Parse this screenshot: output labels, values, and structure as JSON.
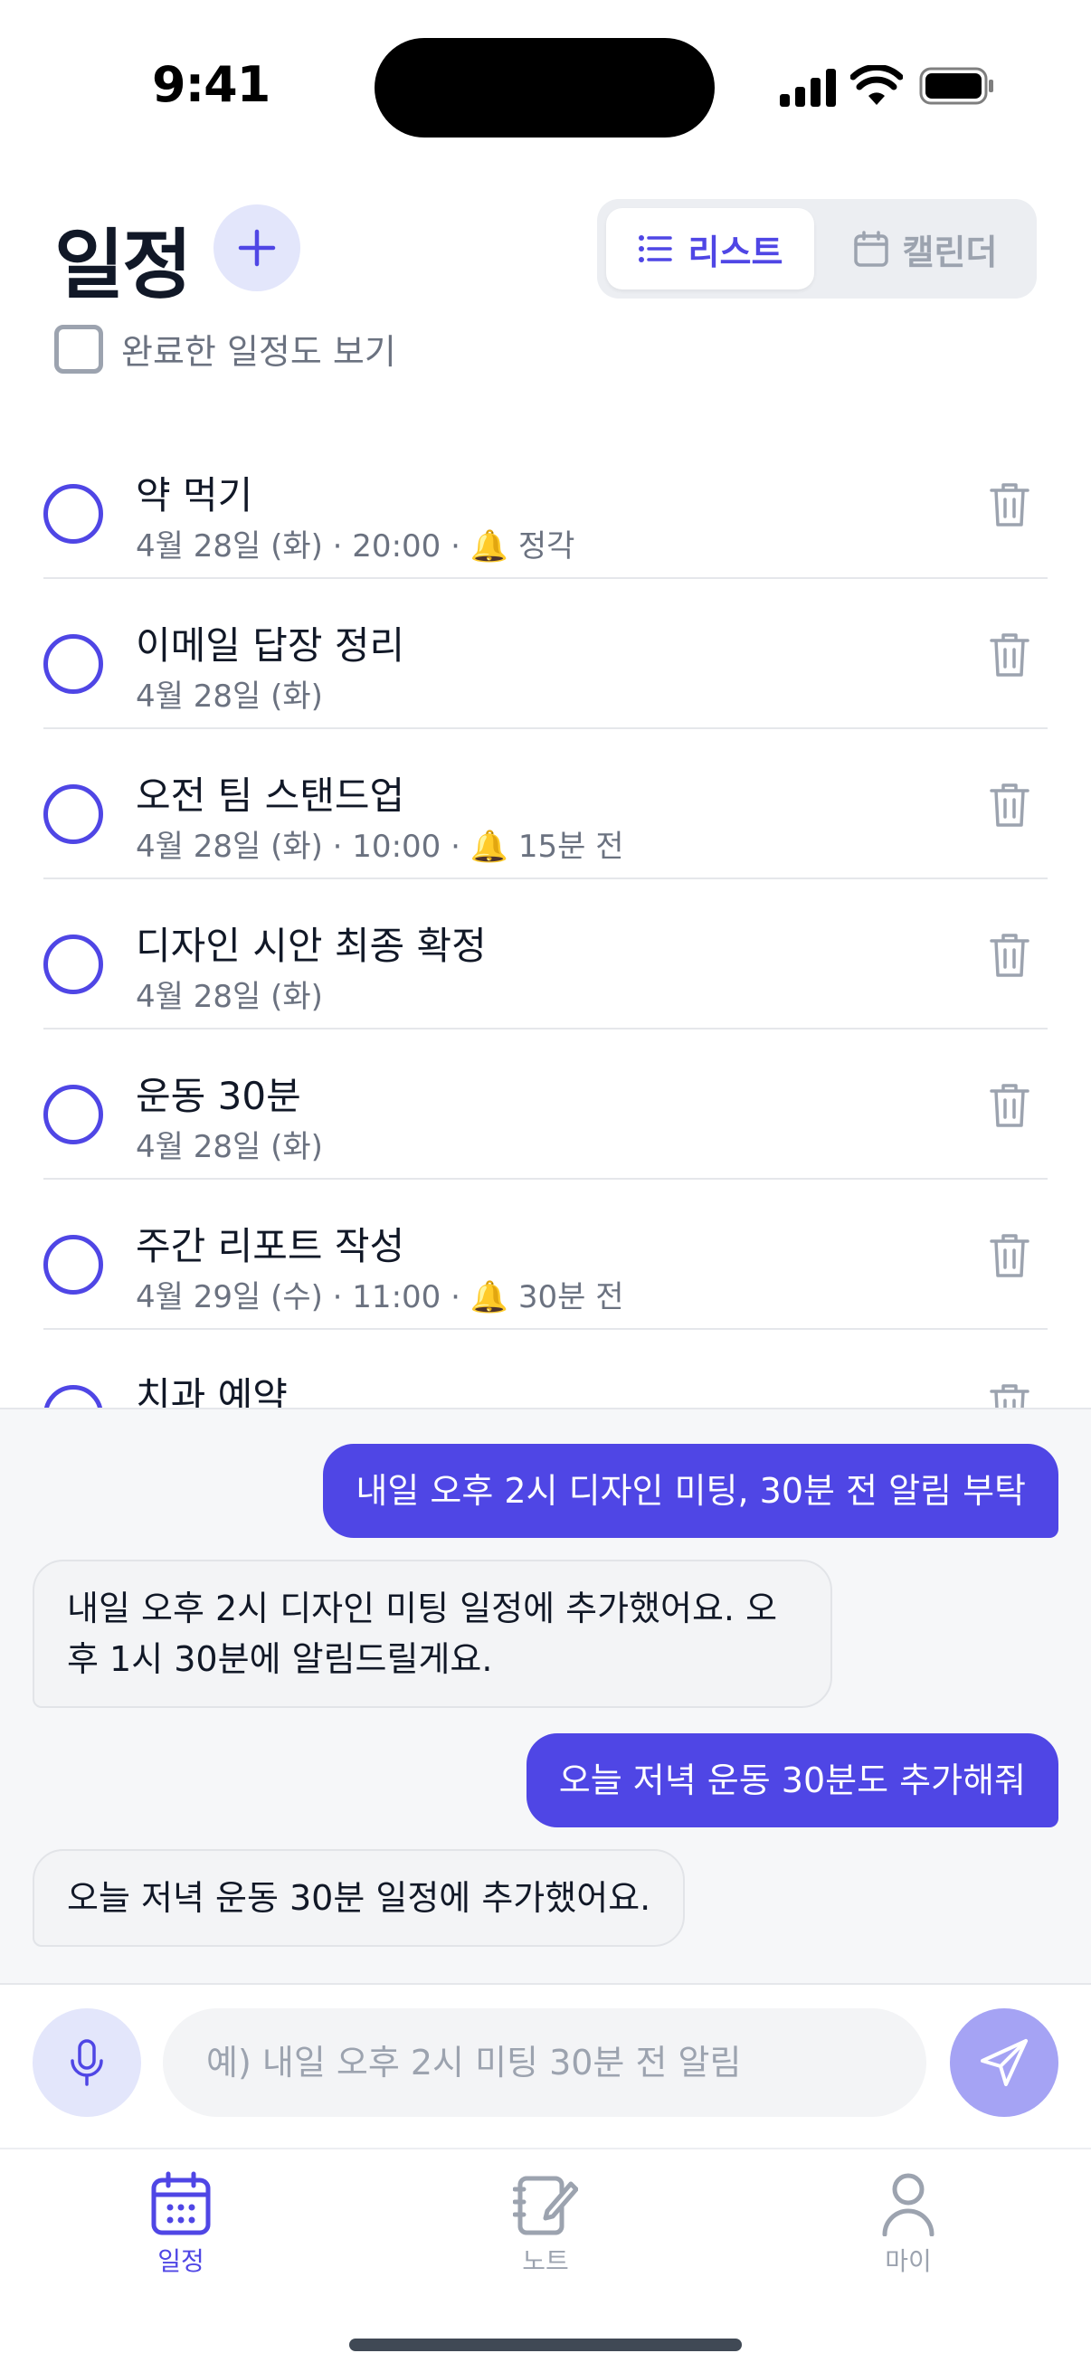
{
  "status_bar": {
    "time": "9:41"
  },
  "header": {
    "title": "일정",
    "view_toggle": {
      "list_label": "리스트",
      "calendar_label": "캘린더",
      "active": "list"
    },
    "show_completed_label": "완료한 일정도 보기",
    "show_completed_checked": false
  },
  "tasks": [
    {
      "title": "약 먹기",
      "meta": "4월 28일 (화) · 20:00 · 🔔 정각"
    },
    {
      "title": "이메일 답장 정리",
      "meta": "4월 28일 (화)"
    },
    {
      "title": "오전 팀 스탠드업",
      "meta": "4월 28일 (화) · 10:00 · 🔔 15분 전"
    },
    {
      "title": "디자인 시안 최종 확정",
      "meta": "4월 28일 (화)"
    },
    {
      "title": "운동 30분",
      "meta": "4월 28일 (화)"
    },
    {
      "title": "주간 리포트 작성",
      "meta": "4월 29일 (수) · 11:00 · 🔔 30분 전"
    },
    {
      "title": "치과 예약",
      "meta": ""
    }
  ],
  "chat": {
    "messages": [
      {
        "role": "user",
        "text": "내일 오후 2시 디자인 미팅, 30분 전 알림 부탁"
      },
      {
        "role": "assistant",
        "text": "내일 오후 2시 디자인 미팅 일정에 추가했어요. 오후 1시 30분에 알림드릴게요."
      },
      {
        "role": "user",
        "text": "오늘 저녁 운동 30분도 추가해줘"
      },
      {
        "role": "assistant",
        "text": "오늘 저녁 운동 30분 일정에 추가했어요."
      }
    ]
  },
  "composer": {
    "placeholder": "예) 내일 오후 2시 미팅 30분 전 알림",
    "value": ""
  },
  "tabbar": {
    "items": [
      {
        "label": "일정",
        "icon": "calendar-icon",
        "active": true
      },
      {
        "label": "노트",
        "icon": "notebook-icon",
        "active": false
      },
      {
        "label": "마이",
        "icon": "person-icon",
        "active": false
      }
    ]
  },
  "colors": {
    "accent": "#4f46e5",
    "accent_light": "#e3e6fb",
    "muted": "#9ca3af"
  }
}
